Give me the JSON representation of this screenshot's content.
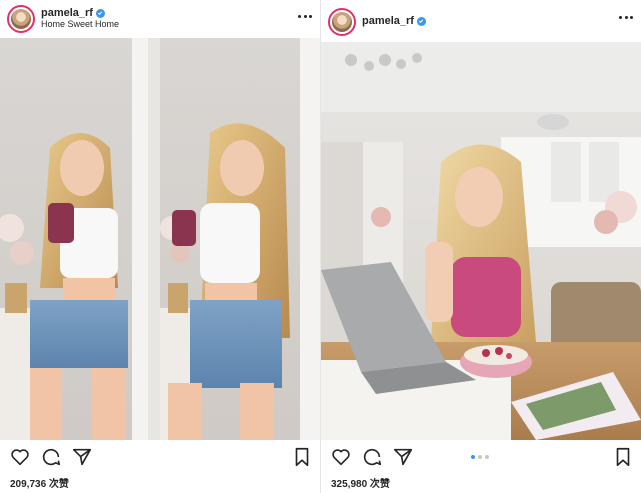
{
  "posts": [
    {
      "username": "pamela_rf",
      "location": "Home Sweet Home",
      "likes": "209,736 次赞"
    },
    {
      "username": "pamela_rf",
      "likes": "325,980 次赞"
    }
  ],
  "carousel": {
    "current": 1,
    "total": 3
  },
  "colors": {
    "verified": "#3897f0",
    "text": "#262626",
    "avatar_ring": "#e1306c",
    "active_dot": "#3897f0",
    "inactive_dot": "#c7c7c7"
  },
  "icons": [
    "heart-icon",
    "comment-icon",
    "share-icon",
    "bookmark-icon",
    "more-icon",
    "verified-badge-icon"
  ]
}
